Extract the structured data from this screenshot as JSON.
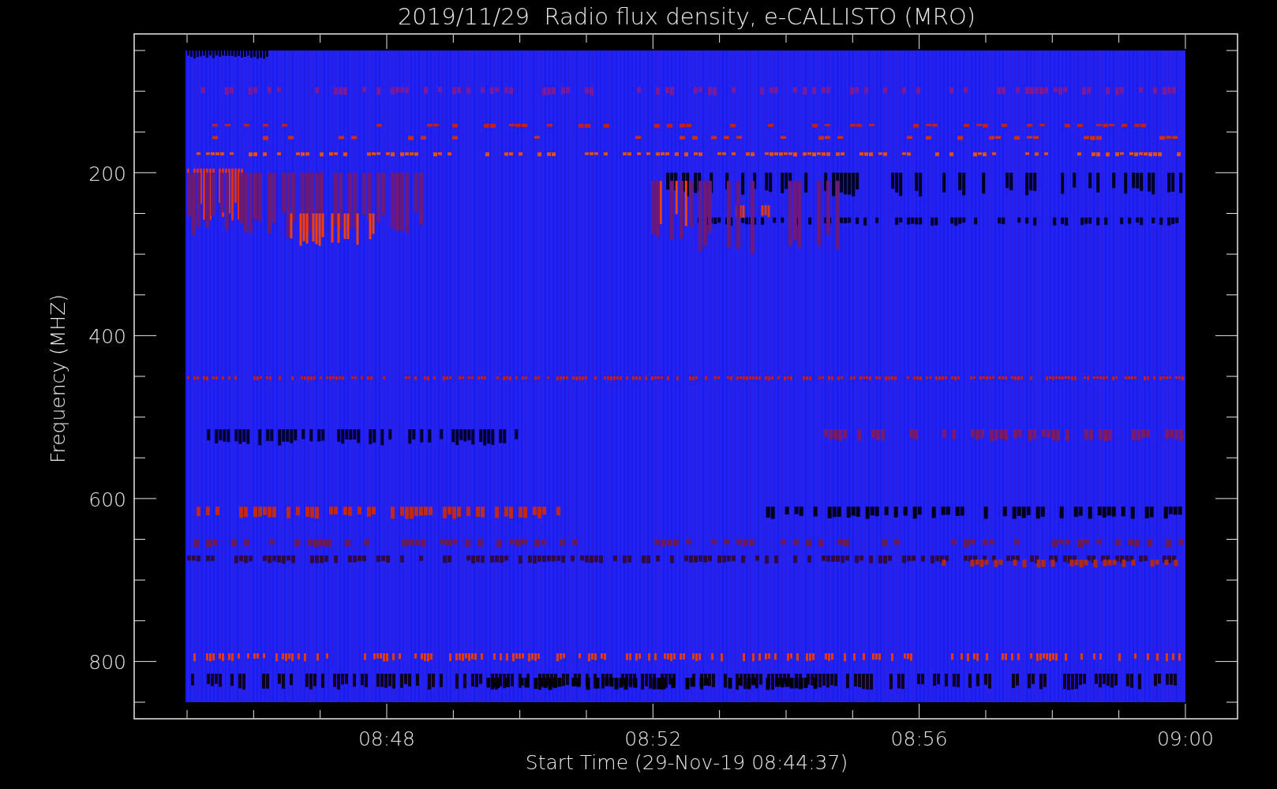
{
  "plot": {
    "title": "2019/11/29  Radio flux density, e-CALLISTO (MRO)",
    "ylabel": "Frequency (MHZ)",
    "xlabel": "Start Time (29-Nov-19 08:44:37)",
    "y_tick_labels": [
      "200",
      "400",
      "600",
      "800"
    ],
    "x_tick_labels": [
      "08:48",
      "08:52",
      "08:56",
      "09:00"
    ]
  }
}
